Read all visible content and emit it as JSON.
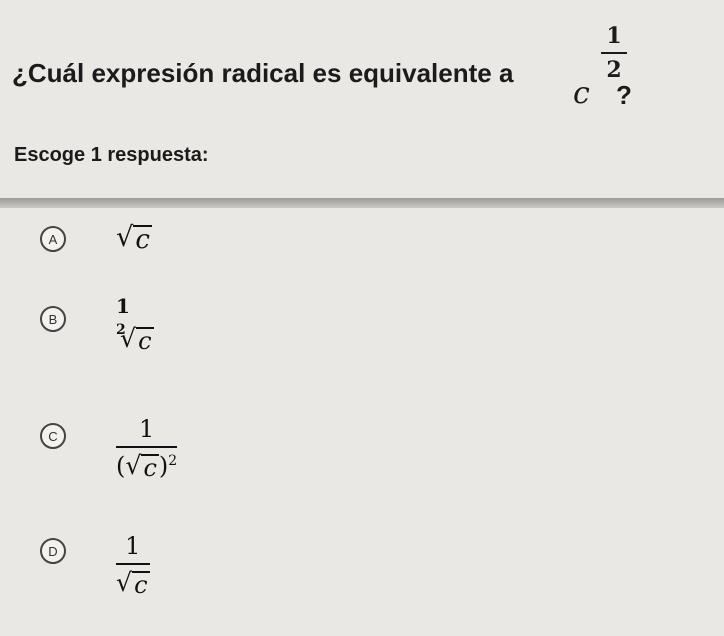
{
  "question": {
    "text": "¿Cuál expresión radical es equivalente a",
    "base": "c",
    "exp_numerator": "1",
    "exp_denominator": "2",
    "end_mark": "?"
  },
  "instruction": "Escoge 1 respuesta:",
  "choices": [
    {
      "letter": "A",
      "radicand": "c"
    },
    {
      "letter": "B",
      "numerator": "1",
      "index": "2",
      "radicand": "c"
    },
    {
      "letter": "C",
      "numerator": "1",
      "radicand": "c",
      "power": "2"
    },
    {
      "letter": "D",
      "numerator": "1",
      "radicand": "c"
    }
  ]
}
